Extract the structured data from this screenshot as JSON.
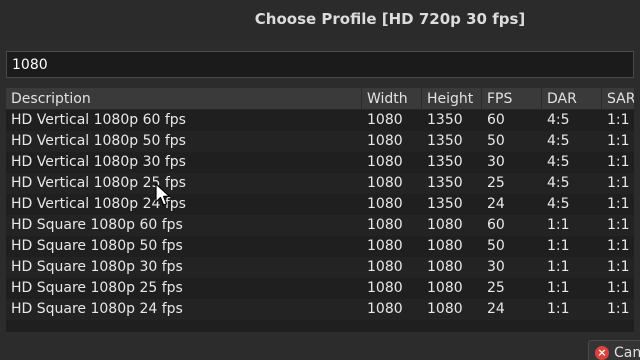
{
  "window": {
    "title": "Choose Profile [HD 720p 30 fps]"
  },
  "search": {
    "value": "1080"
  },
  "table": {
    "columns": [
      "Description",
      "Width",
      "Height",
      "FPS",
      "DAR",
      "SAR"
    ],
    "rows": [
      [
        "HD Vertical 1080p 60 fps",
        "1080",
        "1350",
        "60",
        "4:5",
        "1:1"
      ],
      [
        "HD Vertical 1080p 50 fps",
        "1080",
        "1350",
        "50",
        "4:5",
        "1:1"
      ],
      [
        "HD Vertical 1080p 30 fps",
        "1080",
        "1350",
        "30",
        "4:5",
        "1:1"
      ],
      [
        "HD Vertical 1080p 25 fps",
        "1080",
        "1350",
        "25",
        "4:5",
        "1:1"
      ],
      [
        "HD Vertical 1080p 24 fps",
        "1080",
        "1350",
        "24",
        "4:5",
        "1:1"
      ],
      [
        "HD Square 1080p 60 fps",
        "1080",
        "1080",
        "60",
        "1:1",
        "1:1"
      ],
      [
        "HD Square 1080p 50 fps",
        "1080",
        "1080",
        "50",
        "1:1",
        "1:1"
      ],
      [
        "HD Square 1080p 30 fps",
        "1080",
        "1080",
        "30",
        "1:1",
        "1:1"
      ],
      [
        "HD Square 1080p 25 fps",
        "1080",
        "1080",
        "25",
        "1:1",
        "1:1"
      ],
      [
        "HD Square 1080p 24 fps",
        "1080",
        "1080",
        "24",
        "1:1",
        "1:1"
      ]
    ]
  },
  "buttons": {
    "cancel_label": "Cancel",
    "cancel_icon": "cancel-icon"
  }
}
